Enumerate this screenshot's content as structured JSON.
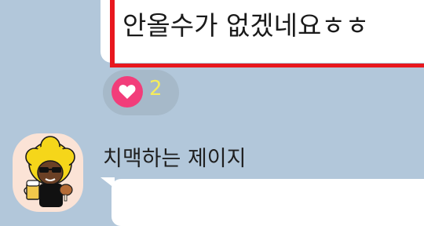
{
  "message": {
    "text": "안올수가 없겠네요ㅎㅎ"
  },
  "reaction": {
    "icon": "heart-icon",
    "count": "2",
    "color": "#f23d7a",
    "count_color": "#f5ec5c"
  },
  "next_message": {
    "sender_name": "치맥하는 제이지",
    "avatar_icon": "character-avatar-icon"
  },
  "colors": {
    "chat_background": "#b2c7da",
    "bubble": "#ffffff",
    "highlight_border": "#e8181e"
  }
}
